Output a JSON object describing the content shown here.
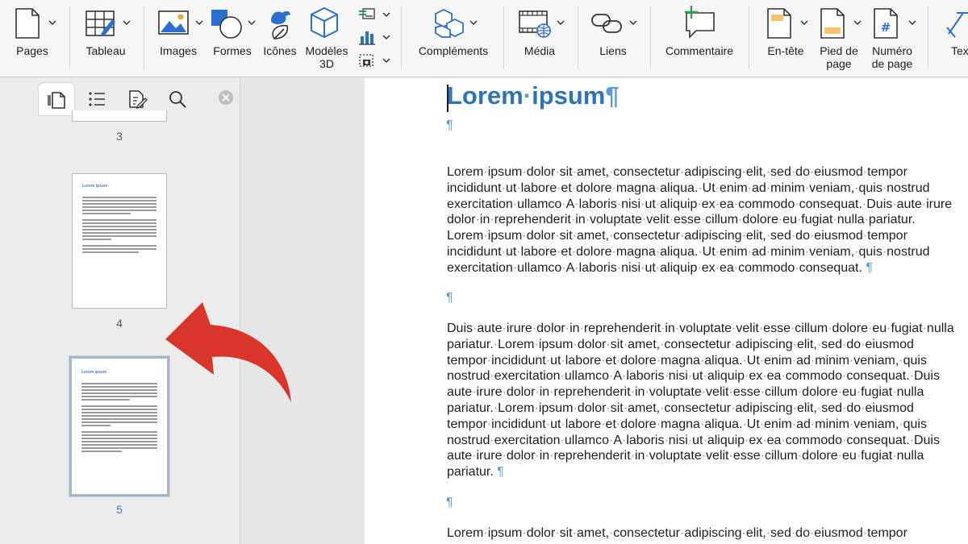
{
  "ribbon": {
    "pages_label": "Pages",
    "table_label": "Tableau",
    "images_label": "Images",
    "shapes_label": "Formes",
    "icons_label": "Icônes",
    "models3d_label_1": "Modèles",
    "models3d_label_2": "3D",
    "addins_label": "Compléments",
    "media_label": "Média",
    "links_label": "Liens",
    "comment_label": "Commentaire",
    "header_label": "En-tête",
    "footer_label_1": "Pied de",
    "footer_label_2": "page",
    "pagenum_label_1": "Numéro",
    "pagenum_label_2": "de page",
    "text_label": "Tex",
    "accent_color": "#2b6fd1",
    "comment_plus_color": "#2e9e4f",
    "footer_fill_color": "#f4c36b"
  },
  "sidebar": {
    "tabs": [
      "thumbnails-tab",
      "outline-tab",
      "reviews-tab",
      "search-tab"
    ],
    "thumbnails": [
      {
        "number": "3"
      },
      {
        "number": "4",
        "title": "Lorem ipsum"
      },
      {
        "number": "5",
        "title": "Lorem ipsum",
        "selected": true
      }
    ]
  },
  "document": {
    "title": "Lorem ipsum",
    "pilcrow": "¶",
    "paragraphs": [
      [
        "Lorem ipsum dolor sit amet, consectetur adipiscing elit, sed do eiusmod tempor",
        "incididunt ut labore et dolore magna aliqua. Ut enim ad minim veniam, quis nostrud",
        "exercitation ullamco A laboris nisi ut aliquip ex ea commodo consequat. Duis aute irure",
        "dolor in reprehenderit in voluptate velit esse cillum dolore eu fugiat nulla pariatur.",
        "Lorem ipsum dolor sit amet, consectetur adipiscing elit, sed do eiusmod tempor",
        "incididunt ut labore et dolore magna aliqua. Ut enim ad minim veniam, quis nostrud",
        "exercitation ullamco A laboris nisi ut aliquip ex ea commodo consequat."
      ],
      [
        "Duis aute irure dolor in reprehenderit in voluptate velit esse cillum dolore eu fugiat nulla",
        "pariatur. Lorem ipsum dolor sit amet, consectetur adipiscing elit, sed do eiusmod",
        "tempor incididunt ut labore et dolore magna aliqua. Ut enim ad minim veniam, quis",
        "nostrud exercitation ullamco A laboris nisi ut aliquip ex ea commodo consequat. Duis",
        "aute irure dolor in reprehenderit in voluptate velit esse cillum dolore eu fugiat nulla",
        "pariatur. Lorem ipsum dolor sit amet, consectetur adipiscing elit, sed do eiusmod",
        "tempor incididunt ut labore et dolore magna aliqua. Ut enim ad minim veniam, quis",
        "nostrud exercitation ullamco A laboris nisi ut aliquip ex ea commodo consequat. Duis",
        "aute irure dolor in reprehenderit in voluptate velit esse cillum dolore eu fugiat nulla",
        "pariatur."
      ],
      [
        "Lorem ipsum dolor sit amet, consectetur adipiscing elit, sed do eiusmod tempor"
      ]
    ]
  },
  "annotation": {
    "arrow_color": "#d9352b"
  }
}
